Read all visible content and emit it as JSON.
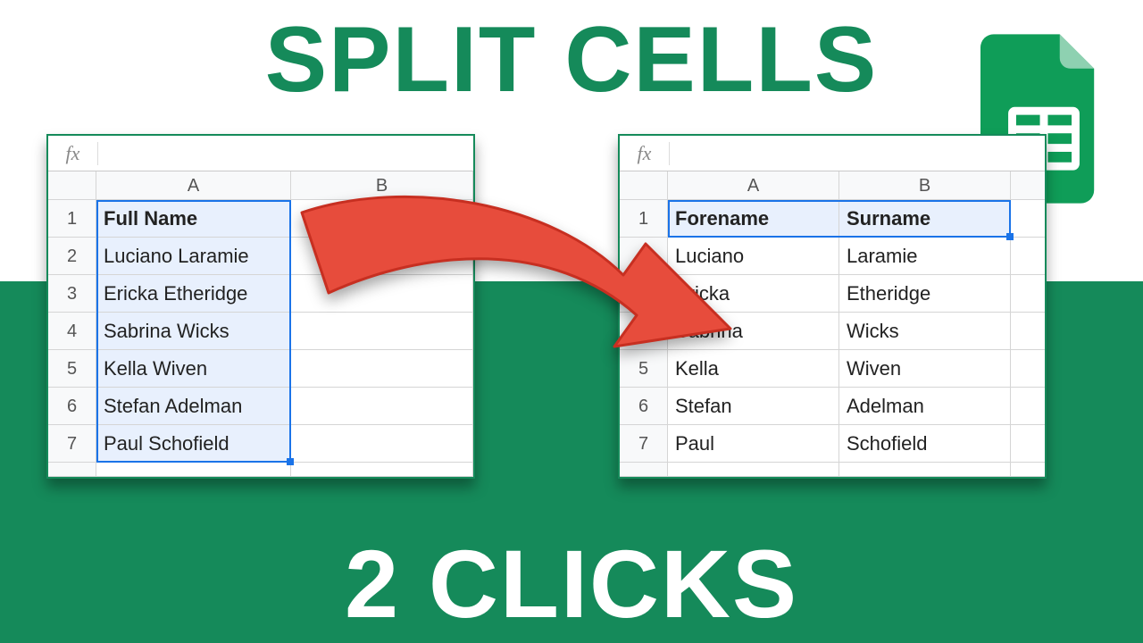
{
  "title": "SPLIT CELLS",
  "subtitle": "2 CLICKS",
  "fx_label": "fx",
  "columns": {
    "A": "A",
    "B": "B"
  },
  "row_numbers": [
    "1",
    "2",
    "3",
    "4",
    "5",
    "6",
    "7"
  ],
  "left_sheet": {
    "header": "Full Name",
    "rows": [
      "Luciano Laramie",
      "Ericka Etheridge",
      "Sabrina Wicks",
      "Kella Wiven",
      "Stefan Adelman",
      "Paul Schofield"
    ]
  },
  "right_sheet": {
    "header_a": "Forename",
    "header_b": "Surname",
    "rows": [
      {
        "a": "Luciano",
        "b": "Laramie"
      },
      {
        "a": "Ericka",
        "b": "Etheridge"
      },
      {
        "a": "Sabrina",
        "b": "Wicks"
      },
      {
        "a": "Kella",
        "b": "Wiven"
      },
      {
        "a": "Stefan",
        "b": "Adelman"
      },
      {
        "a": "Paul",
        "b": "Schofield"
      }
    ]
  },
  "colors": {
    "brand_green": "#158a5a",
    "arrow_red": "#e74c3c",
    "selection_blue": "#1a73e8"
  }
}
